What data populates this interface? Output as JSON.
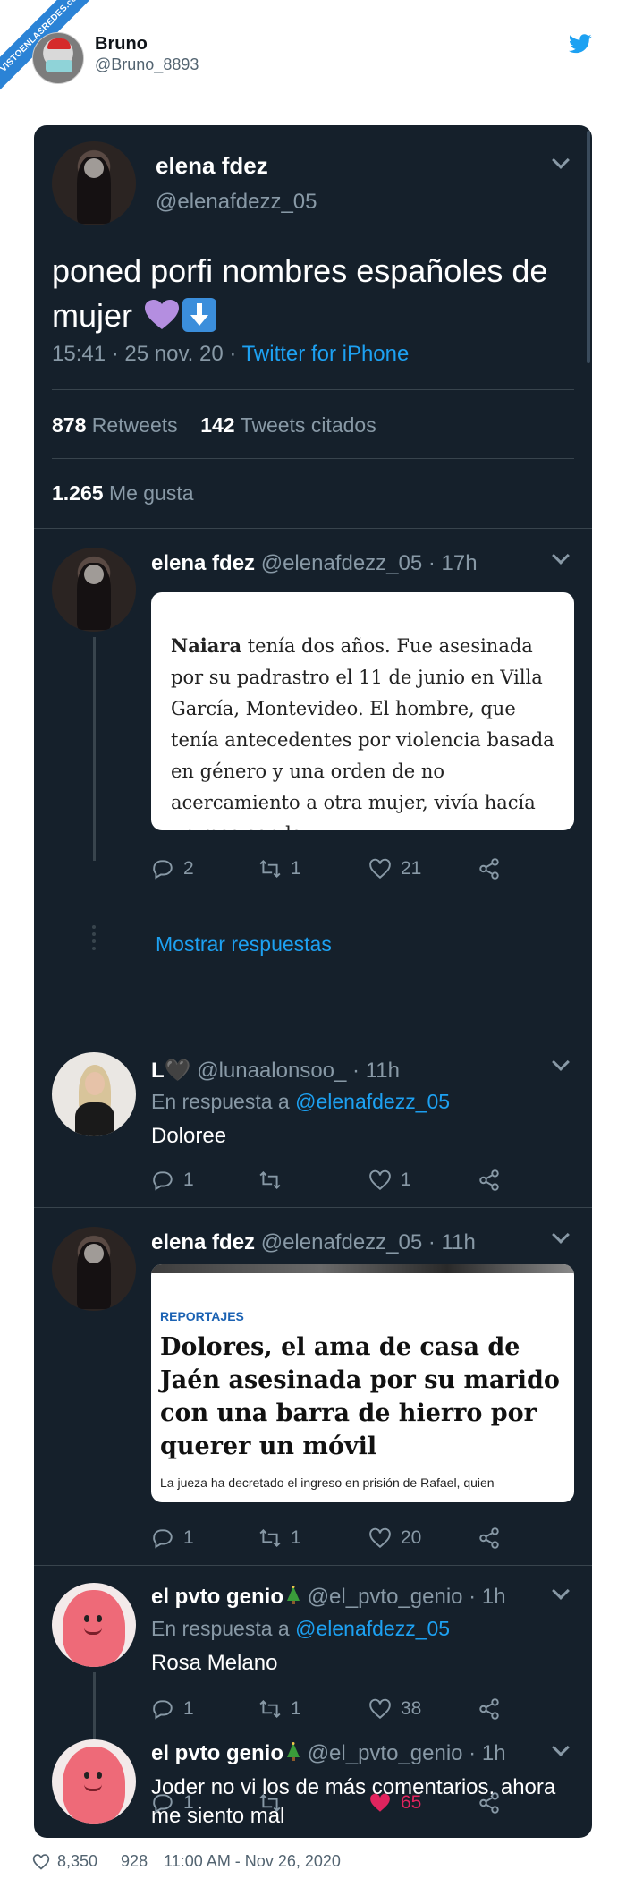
{
  "embed": {
    "ribbon_text": "VISTOENLASREDES.com",
    "author_name": "Bruno",
    "author_handle": "@Bruno_8893",
    "footer_likes": "8,350",
    "footer_replies": "928",
    "footer_timestamp": "11:00 AM - Nov 26, 2020",
    "brand_color": "#1da1f2"
  },
  "main_tweet": {
    "name": "elena fdez",
    "handle": "@elenafdezz_05",
    "text": "poned porfi nombres españoles de mujer",
    "emoji": [
      "purple-heart-icon",
      "down-arrow-icon"
    ],
    "time": "15:41 · 25 nov. 20 · ",
    "client": "Twitter for iPhone",
    "retweets_count": "878",
    "retweets_label": "Retweets",
    "quotes_count": "142",
    "quotes_label": "Tweets citados",
    "likes_count": "1.265",
    "likes_label": "Me gusta"
  },
  "replies": [
    {
      "name": "elena fdez",
      "meta": "@elenafdezz_05 · 17h",
      "card_text_bold": "Naiara",
      "card_text": " tenía dos años. Fue asesinada por su padrastro el 11 de junio en Villa García, Montevideo. El hombre, que tenía antecedentes por violencia basada en género y una orden de no acercamiento a otra mujer, vivía hacía un mes con la",
      "replies": "2",
      "retweets": "1",
      "likes": "21",
      "show_replies": "Mostrar respuestas"
    },
    {
      "name": "L🖤",
      "meta": "@lunaalonsoo_ · 11h",
      "in_reply_label": "En respuesta a ",
      "in_reply_to": "@elenafdezz_05",
      "text": "Doloree",
      "replies": "1",
      "retweets": "",
      "likes": "1"
    },
    {
      "name": "elena fdez",
      "meta": "@elenafdezz_05 · 11h",
      "card_section": "REPORTAJES",
      "card_headline": "Dolores, el ama de casa de Jaén asesinada por su marido con una barra de hierro por querer un móvil",
      "card_excerpt": "La jueza ha decretado el ingreso en prisión de Rafael, quien",
      "replies": "1",
      "retweets": "1",
      "likes": "20"
    },
    {
      "name": "el pvto genio",
      "meta": "@el_pvto_genio · 1h",
      "in_reply_label": "En respuesta a ",
      "in_reply_to": "@elenafdezz_05",
      "text": "Rosa Melano",
      "replies": "1",
      "retweets": "1",
      "likes": "38"
    },
    {
      "name": "el pvto genio",
      "meta": "@el_pvto_genio · 1h",
      "text": "Joder no vi los de más comentarios, ahora me siento mal",
      "replies": "1",
      "retweets": "",
      "likes": "65",
      "liked": true,
      "like_color": "#e0245e"
    }
  ]
}
